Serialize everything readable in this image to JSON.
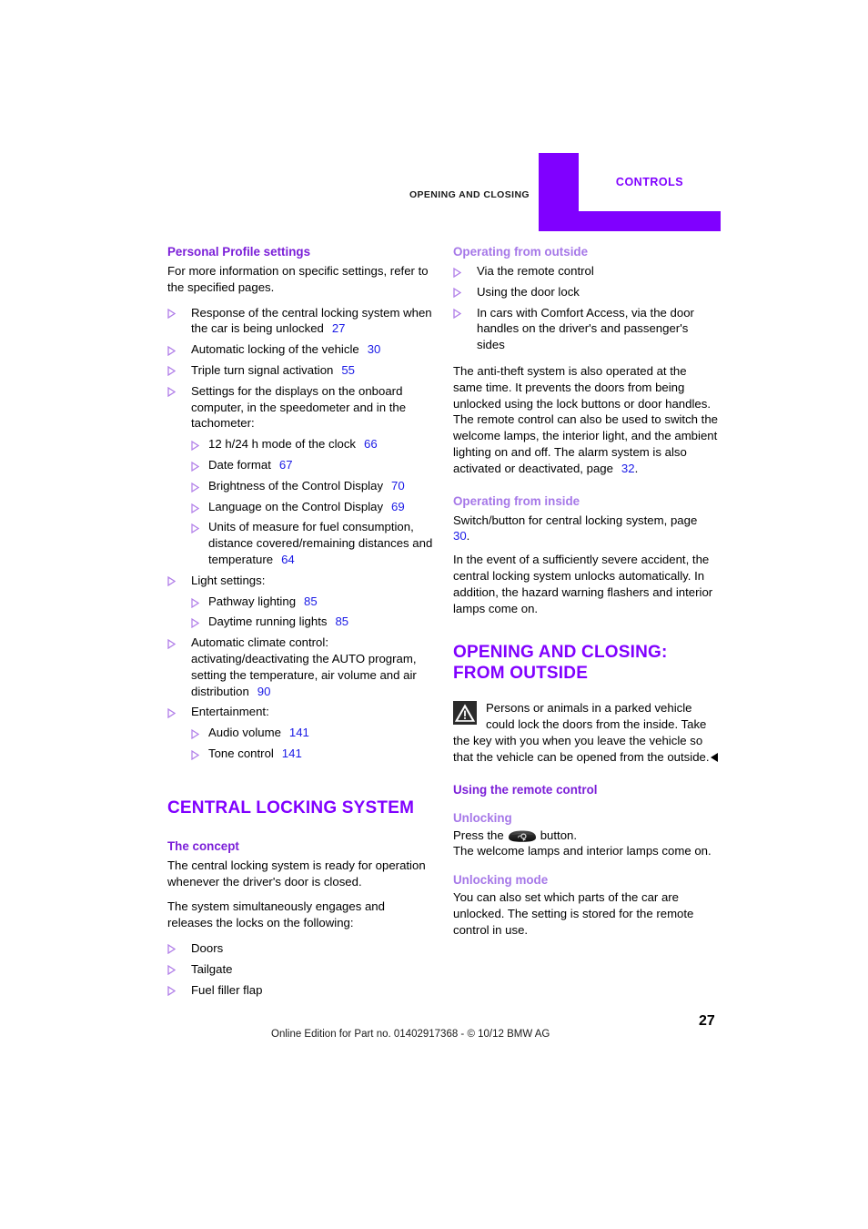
{
  "header": {
    "chapter_label": "OPENING AND CLOSING",
    "tab_label": "CONTROLS",
    "tab_color": "#8000ff"
  },
  "colors": {
    "accent_purple": "#8000ff",
    "heading_purple": "#7b1fd8",
    "subheading_purple": "#a678e8",
    "page_ref_blue": "#1a1ae6",
    "bullet_purple": "#b07de8"
  },
  "left_column": {
    "personal_profile": {
      "heading": "Personal Profile settings",
      "intro": "For more information on specific settings, refer to the specified pages.",
      "items": [
        {
          "text": "Response of the central locking system when the car is being unlocked",
          "page": "27"
        },
        {
          "text": "Automatic locking of the vehicle",
          "page": "30"
        },
        {
          "text": "Triple turn signal activation",
          "page": "55"
        },
        {
          "text": "Settings for the displays on the onboard computer, in the speedometer and in the tachometer:",
          "page": "",
          "subitems": [
            {
              "text": "12 h/24 h mode of the clock",
              "page": "66"
            },
            {
              "text": "Date format",
              "page": "67"
            },
            {
              "text": "Brightness of the Control Display",
              "page": "70"
            },
            {
              "text": "Language on the Control Display",
              "page": "69"
            },
            {
              "text": "Units of measure for fuel consumption, distance covered/remaining distances and temperature",
              "page": "64"
            }
          ]
        },
        {
          "text": "Light settings:",
          "page": "",
          "subitems": [
            {
              "text": "Pathway lighting",
              "page": "85"
            },
            {
              "text": "Daytime running lights",
              "page": "85"
            }
          ]
        },
        {
          "text": "Automatic climate control: activating/deactivating the AUTO program, setting the temperature, air volume and air distribution",
          "page": "90"
        },
        {
          "text": "Entertainment:",
          "page": "",
          "subitems": [
            {
              "text": "Audio volume",
              "page": "141"
            },
            {
              "text": "Tone control",
              "page": "141"
            }
          ]
        }
      ]
    },
    "central_locking": {
      "title": "CENTRAL LOCKING SYSTEM",
      "concept_heading": "The concept",
      "para1": "The central locking system is ready for operation whenever the driver's door is closed.",
      "para2": "The system simultaneously engages and releases the locks on the following:",
      "items": [
        {
          "text": "Doors"
        },
        {
          "text": "Tailgate"
        },
        {
          "text": "Fuel filler flap"
        }
      ]
    }
  },
  "right_column": {
    "operating_outside": {
      "heading": "Operating from outside",
      "items": [
        {
          "text": "Via the remote control"
        },
        {
          "text": "Using the door lock"
        },
        {
          "text": "In cars with Comfort Access, via the door handles on the driver's and passenger's sides"
        }
      ],
      "para_a": "The anti-theft system is also operated at the same time. It prevents the doors from being unlocked using the lock buttons or door handles. The remote control can also be used to switch the welcome lamps, the interior light, and the ambient lighting on and off. The alarm system is also activated or deactivated, page ",
      "para_a_page": "32",
      "para_a_end": "."
    },
    "operating_inside": {
      "heading": "Operating from inside",
      "para_a": "Switch/button for central locking system, page ",
      "para_a_page": "30",
      "para_a_end": ".",
      "para_b": "In the event of a sufficiently severe accident, the central locking system unlocks automatically. In addition, the hazard warning flashers and interior lamps come on."
    },
    "opening_from_outside": {
      "title_line1": "OPENING AND CLOSING:",
      "title_line2": "FROM OUTSIDE",
      "warning_icon": "warning-triangle-icon",
      "warning_text": "Persons or animals in a parked vehicle could lock the doors from the inside. Take the key with you when you leave the vehicle so that the vehicle can be opened from the outside.",
      "remote_heading": "Using the remote control",
      "unlocking_heading": "Unlocking",
      "unlocking_text_before": "Press the",
      "unlocking_button_icon": "remote-unlock-button-icon",
      "unlocking_text_after": "button.",
      "unlocking_text_line2": "The welcome lamps and interior lamps come on.",
      "unlocking_mode_heading": "Unlocking mode",
      "unlocking_mode_text": "You can also set which parts of the car are unlocked. The setting is stored for the remote control in use."
    }
  },
  "footer": {
    "edition_note": "Online Edition for Part no. 01402917368 - © 10/12 BMW AG",
    "page_number": "27"
  }
}
